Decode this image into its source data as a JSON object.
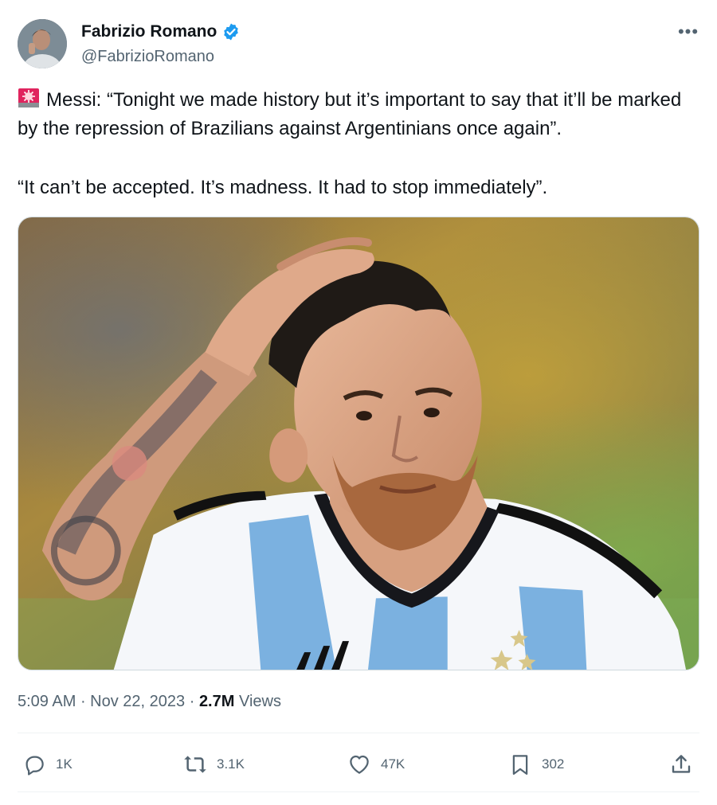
{
  "author": {
    "display_name": "Fabrizio Romano",
    "handle": "@FabrizioRomano",
    "verified_icon": "verified-badge-icon"
  },
  "more_icon": "more-icon",
  "tweet": {
    "siren_icon": "siren-emoji-icon",
    "paragraph1": "Messi: “Tonight we made history but it’s important to say that it’ll be marked by the repression of Brazilians against Argentinians once again”.",
    "paragraph2": "“It can’t be accepted. It’s madness. It had to stop immediately”."
  },
  "meta": {
    "time": "5:09 AM",
    "sep1": " · ",
    "date": "Nov 22, 2023",
    "sep2": " · ",
    "views_count": "2.7M",
    "views_label": " Views"
  },
  "actions": {
    "replies": "1K",
    "reposts": "3.1K",
    "likes": "47K",
    "bookmarks": "302"
  },
  "colors": {
    "text": "#0f1419",
    "secondary": "#536471",
    "verified": "#1d9bf0"
  }
}
